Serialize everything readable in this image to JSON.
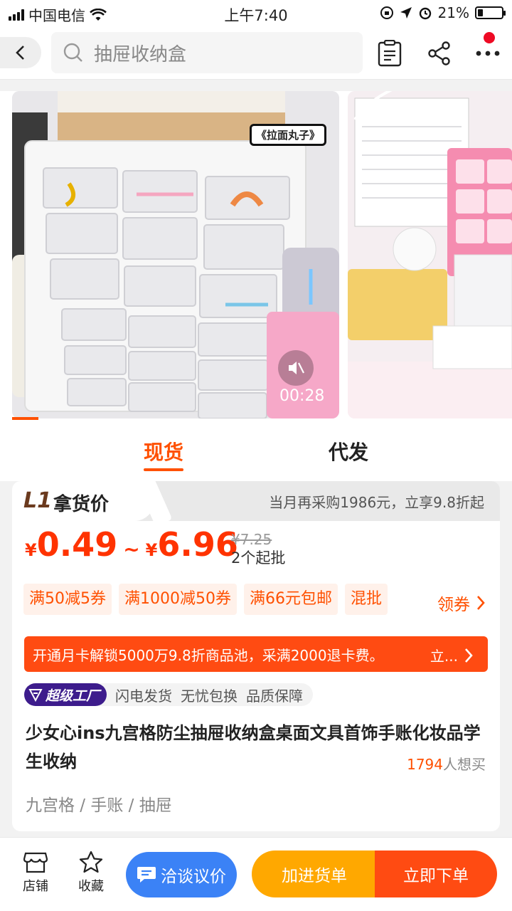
{
  "status_bar": {
    "carrier": "中国电信",
    "time": "上午7:40",
    "battery": "21%",
    "battery_level": 0.21
  },
  "header": {
    "search_placeholder": "抽屉收纳盒"
  },
  "media": {
    "overlay_label": "《拉面丸子》",
    "duration": "00:28",
    "progress": 0.08
  },
  "tabs": [
    {
      "label": "现货",
      "active": true
    },
    {
      "label": "代发",
      "active": false
    }
  ],
  "price": {
    "level_badge": "L1",
    "title": "拿货价",
    "note": "当月再采购1986元，立享9.8折起",
    "currency": "¥",
    "min": "0.49",
    "separator": "~",
    "max": "6.96",
    "original": "¥7.25",
    "min_qty": "2个起批"
  },
  "coupons": [
    "满50减5券",
    "满1000减50券",
    "满66元包邮",
    "混批"
  ],
  "get_coupon": "领券",
  "banner": {
    "text": "开通月卡解锁5000万9.8折商品池，采满2000退卡费。",
    "cta": "立..."
  },
  "service": {
    "badge": "超级工厂",
    "items": [
      "闪电发货",
      "无忧包换",
      "品质保障"
    ]
  },
  "product": {
    "title": "少女心ins九宫格防尘抽屉收纳盒桌面文具首饰手账化妆品学生收纳",
    "want_count": "1794",
    "want_suffix": "人想买",
    "categories": "九宫格 / 手账 / 抽屉"
  },
  "bottom_bar": {
    "shop": "店铺",
    "favorite": "收藏",
    "negotiate": "洽谈议价",
    "add_cart": "加进货单",
    "buy_now": "立即下单"
  },
  "colors": {
    "accent": "#ff5000",
    "price": "#ff3300",
    "banner": "#ff4b12",
    "negotiate": "#3b82f6",
    "cart": "#ffa800",
    "factory": "#3d1c8c"
  }
}
